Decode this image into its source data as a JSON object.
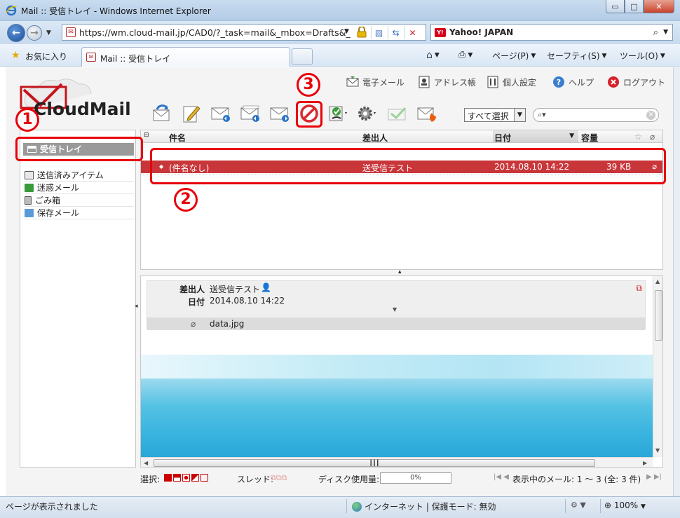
{
  "window": {
    "title": "Mail :: 受信トレイ - Windows Internet Explorer",
    "min": "▭",
    "max": "□",
    "close": "✕"
  },
  "address": {
    "url": "https://wm.cloud-mail.jp/CAD0/?_task=mail&_mbox=Drafts&_",
    "search_engine": "Yahoo! JAPAN",
    "yahoo_badge": "Y!"
  },
  "favbar": {
    "favorites": "お気に入り",
    "tab_title": "Mail :: 受信トレイ",
    "commands": [
      "ページ(P)",
      "セーフティ(S)",
      "ツール(O)"
    ]
  },
  "app": {
    "logo": "CloudMail",
    "toplinks": [
      "電子メール",
      "アドレス帳",
      "個人設定",
      "ヘルプ",
      "ログアウト"
    ],
    "select_all": "すべて選択",
    "search_placeholder": ""
  },
  "sidebar": {
    "current_folder": "受信トレイ",
    "folders": [
      "送信済みアイテム",
      "迷惑メール",
      "ごみ箱",
      "保存メール"
    ]
  },
  "list": {
    "columns": {
      "subject": "件名",
      "from": "差出人",
      "date": "日付",
      "size": "容量"
    },
    "selected_row": {
      "subject": "(件名なし)",
      "from": "送受信テスト",
      "date": "2014.08.10 14:22",
      "size": "39 KB"
    }
  },
  "preview": {
    "from_label": "差出人",
    "from_value": "送受信テスト",
    "date_label": "日付",
    "date_value": "2014.08.10 14:22",
    "attachment": "data.jpg"
  },
  "footer": {
    "select_label": "選択:",
    "thread_label": "スレッド:",
    "disk_label": "ディスク使用量:",
    "disk_usage": "0%",
    "paging": "表示中のメール: 1 ～ 3 (全: 3 件)"
  },
  "annotations": [
    "1",
    "2",
    "3"
  ],
  "status": {
    "text": "ページが表示されました",
    "zone": "インターネット | 保護モード: 無効",
    "zoom": "100%"
  },
  "colors": {
    "accent_red": "#e8000a",
    "selected_row": "#c9363a"
  }
}
